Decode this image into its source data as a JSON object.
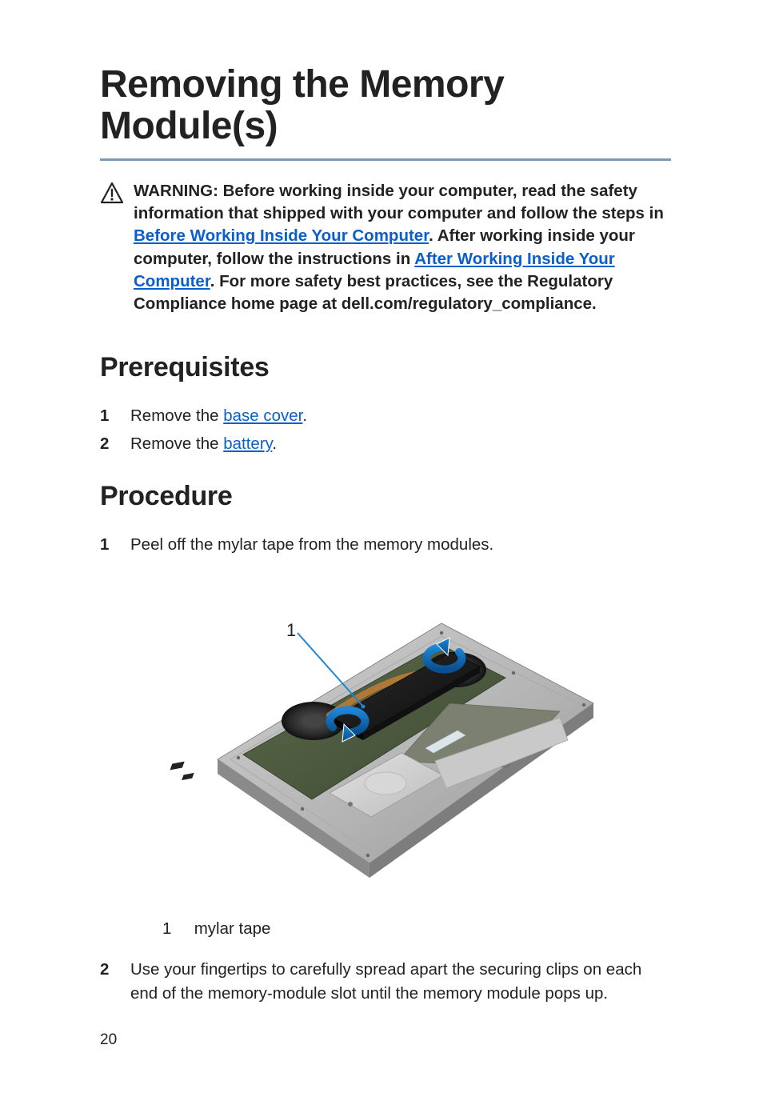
{
  "title": "Removing the Memory Module(s)",
  "warning": {
    "prefix": "WARNING: Before working inside your computer, read the safety information that shipped with your computer and follow the steps in ",
    "link1_text": "Before Working Inside Your Computer",
    "mid1": ". After working inside your computer, follow the instructions in ",
    "link2_text": "After Working Inside Your Computer",
    "suffix": ". For more safety best practices, see the Regulatory Compliance home page at dell.com/regulatory_compliance."
  },
  "sections": {
    "prerequisites": {
      "heading": "Prerequisites",
      "items": [
        {
          "num": "1",
          "before": "Remove the ",
          "link": "base cover",
          "after": "."
        },
        {
          "num": "2",
          "before": "Remove the ",
          "link": "battery",
          "after": "."
        }
      ]
    },
    "procedure": {
      "heading": "Procedure",
      "items": [
        {
          "num": "1",
          "text": "Peel off the mylar tape from the memory modules."
        },
        {
          "num": "2",
          "text": "Use your fingertips to carefully spread apart the securing clips on each end of the memory-module slot until the memory module pops up."
        }
      ]
    }
  },
  "figure": {
    "callout_number": "1",
    "legend": {
      "num": "1",
      "label": "mylar tape"
    }
  },
  "page_number": "20"
}
